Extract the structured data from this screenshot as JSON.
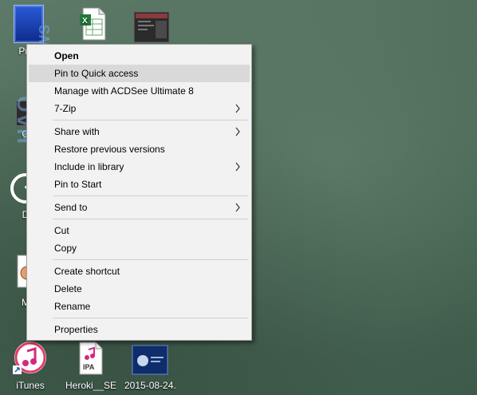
{
  "desktop": {
    "icons": [
      {
        "label": "Proo",
        "icon": "game-box-icon"
      },
      {
        "label": "",
        "icon": "excel-file-icon"
      },
      {
        "label": "",
        "icon": "screenshot-thumbnail-icon"
      },
      {
        "label": "GA",
        "icon": "game-icon"
      },
      {
        "label": "D",
        "icon": "clock-shortcut-icon"
      },
      {
        "label": "M",
        "icon": "program-icon"
      },
      {
        "label": "iTunes",
        "icon": "itunes-icon"
      },
      {
        "label": "Heroki__SE...",
        "icon": "ipa-file-icon"
      },
      {
        "label": "2015-08-24...",
        "icon": "image-file-icon"
      }
    ],
    "ipa_badge": "IPA"
  },
  "watermark": {
    "line1": "HAQ",
    "line2": "REVIEWS"
  },
  "menu": {
    "items": [
      {
        "label": "Open"
      },
      {
        "label": "Pin to Quick access"
      },
      {
        "label": "Manage with ACDSee Ultimate 8"
      },
      {
        "label": "7-Zip"
      },
      {
        "label": "Share with"
      },
      {
        "label": "Restore previous versions"
      },
      {
        "label": "Include in library"
      },
      {
        "label": "Pin to Start"
      },
      {
        "label": "Send to"
      },
      {
        "label": "Cut"
      },
      {
        "label": "Copy"
      },
      {
        "label": "Create shortcut"
      },
      {
        "label": "Delete"
      },
      {
        "label": "Rename"
      },
      {
        "label": "Properties"
      }
    ]
  }
}
